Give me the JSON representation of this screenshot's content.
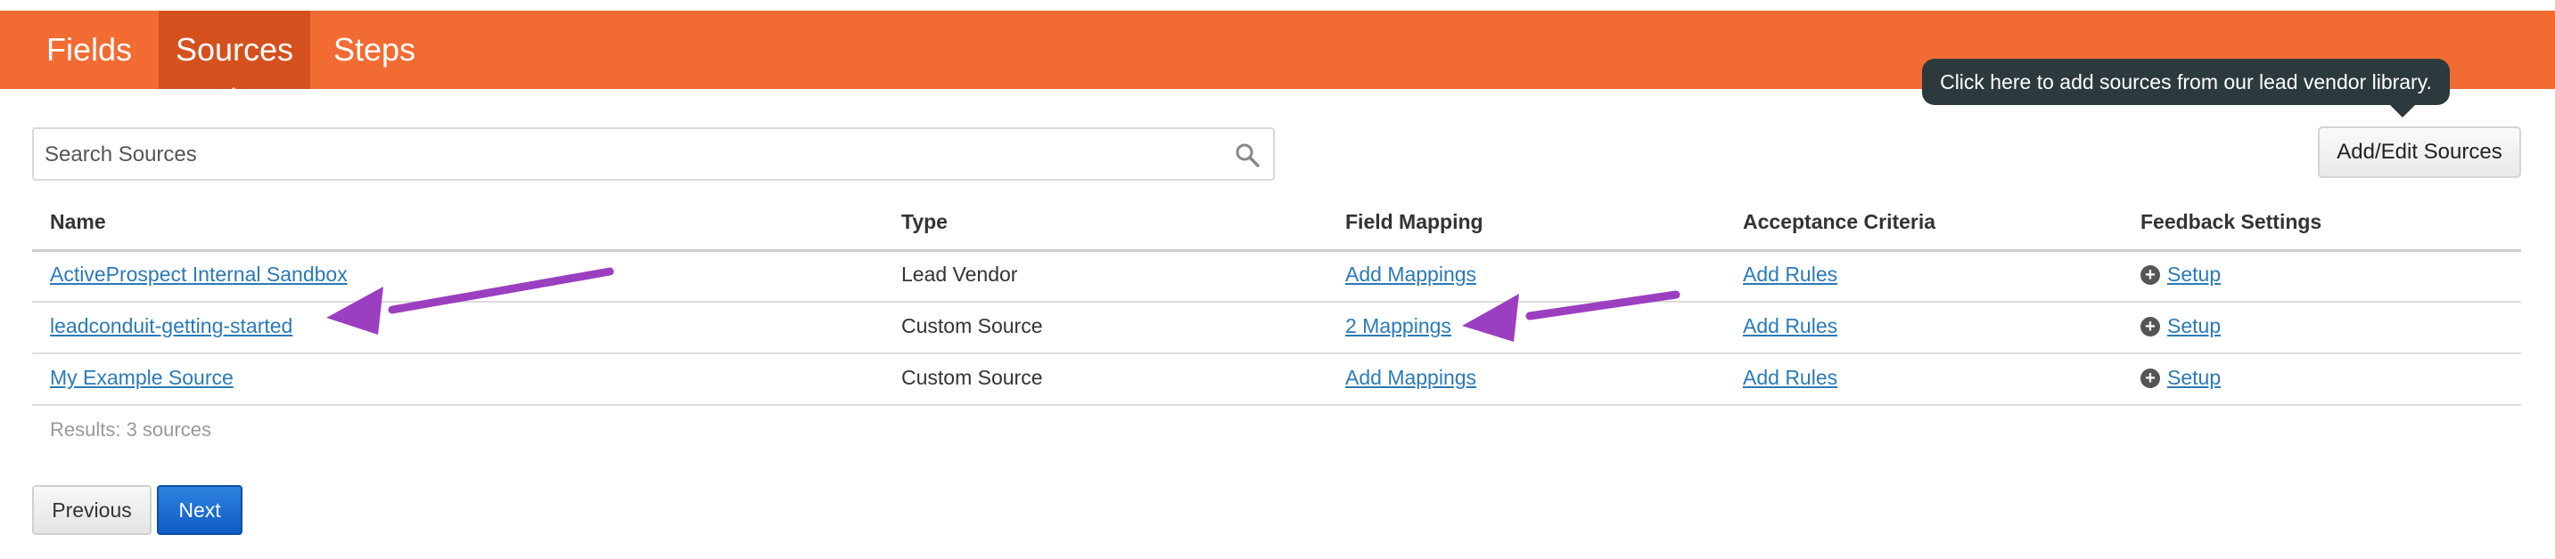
{
  "nav": {
    "tabs": [
      {
        "label": "Fields",
        "active": false
      },
      {
        "label": "Sources",
        "active": true
      },
      {
        "label": "Steps",
        "active": false
      }
    ]
  },
  "tooltip": {
    "text": "Click here to add sources from our lead vendor library."
  },
  "search": {
    "placeholder": "Search Sources",
    "icon": "search-icon"
  },
  "toolbar": {
    "add_edit_label": "Add/Edit Sources"
  },
  "table": {
    "headers": [
      "Name",
      "Type",
      "Field Mapping",
      "Acceptance Criteria",
      "Feedback Settings"
    ],
    "rows": [
      {
        "name": "ActiveProspect Internal Sandbox",
        "type": "Lead Vendor",
        "mapping": "Add Mappings",
        "criteria": "Add Rules",
        "feedback": "Setup"
      },
      {
        "name": "leadconduit-getting-started",
        "type": "Custom Source",
        "mapping": "2 Mappings",
        "criteria": "Add Rules",
        "feedback": "Setup"
      },
      {
        "name": "My Example Source",
        "type": "Custom Source",
        "mapping": "Add Mappings",
        "criteria": "Add Rules",
        "feedback": "Setup"
      }
    ],
    "results": "Results: 3 sources"
  },
  "pagination": {
    "previous_label": "Previous",
    "next_label": "Next"
  },
  "colors": {
    "nav_bg": "#f26b33",
    "nav_active": "#d4511e",
    "link": "#2a7ab8",
    "annotation_arrow": "#9b3fc0",
    "next_button": "#0e5cc4",
    "tooltip_bg": "#2d3a3d"
  }
}
